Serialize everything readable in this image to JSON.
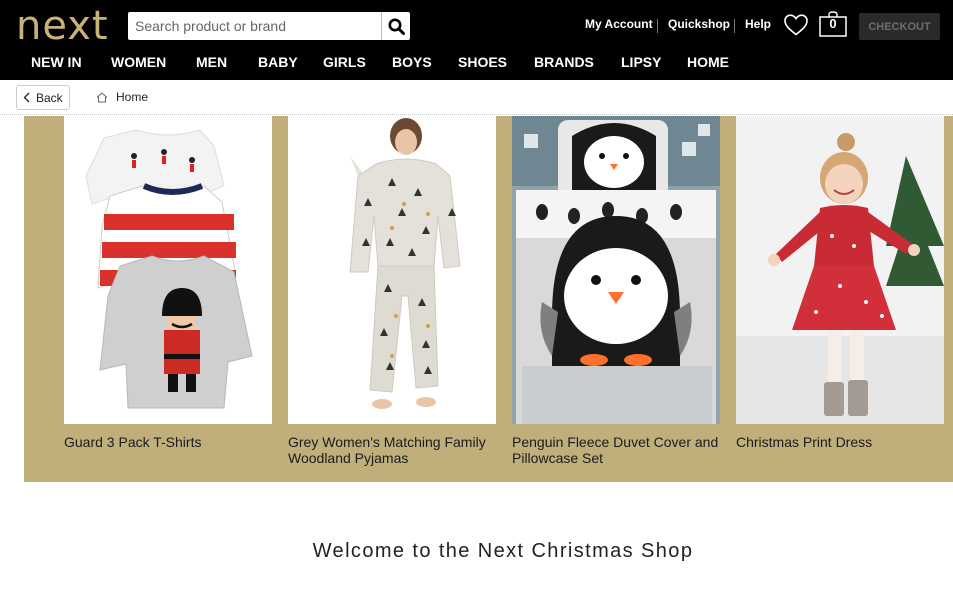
{
  "header": {
    "logo_text": "next",
    "search": {
      "placeholder": "Search product or brand",
      "value": ""
    },
    "utility_links": [
      "My Account",
      "Quickshop",
      "Help"
    ],
    "bag_count": "0",
    "checkout_label": "CHECKOUT"
  },
  "nav": {
    "items": [
      "NEW IN",
      "WOMEN",
      "MEN",
      "BABY",
      "GIRLS",
      "BOYS",
      "SHOES",
      "BRANDS",
      "LIPSY",
      "HOME"
    ]
  },
  "breadcrumb": {
    "back_label": "Back",
    "home_label": "Home"
  },
  "products": [
    {
      "title": "Guard 3 Pack T-Shirts"
    },
    {
      "title": "Grey Women's Matching Family Woodland Pyjamas"
    },
    {
      "title": "Penguin Fleece Duvet Cover and Pillowcase Set"
    },
    {
      "title": "Christmas Print Dress"
    }
  ],
  "welcome_heading": "Welcome to the Next Christmas Shop",
  "colors": {
    "header_bg": "#000000",
    "banner_bg": "#c0ae7b",
    "logo_gold": "#c9b27a",
    "checkout_bg": "#2a2a2a"
  },
  "icons": [
    "search-icon",
    "heart-icon",
    "shopping-bag-icon",
    "chevron-left-icon",
    "home-icon"
  ]
}
